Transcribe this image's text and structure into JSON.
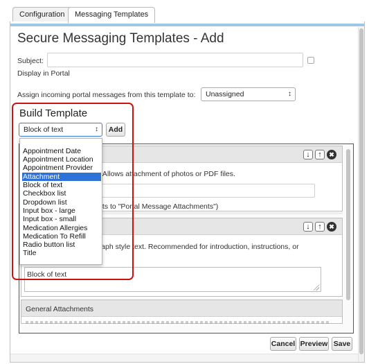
{
  "tabs": [
    {
      "label": "Configuration",
      "active": false
    },
    {
      "label": "Messaging Templates",
      "active": true
    }
  ],
  "form": {
    "title": "Secure Messaging Templates - Add",
    "subject_label": "Subject:",
    "subject_value": "",
    "display_in_portal_label": "Display in Portal",
    "display_in_portal_checked": false,
    "assign_label": "Assign incoming portal messages from this template to:",
    "assign_value": "Unassigned"
  },
  "build": {
    "title": "Build Template",
    "type_select_value": "Block of text",
    "add_label": "Add",
    "options": [
      "Appointment Date",
      "Appointment Location",
      "Appointment Provider",
      "Attachment",
      "Block of text",
      "Checkbox list",
      "Dropdown list",
      "Input box - large",
      "Input box - small",
      "Medication Allergies",
      "Medication To Refill",
      "Radio button list",
      "Title"
    ],
    "highlighted_option": "Attachment"
  },
  "cards": [
    {
      "desc": "on. Allows attachment of photos or PDF files.",
      "folder_hint": "faults to \"Portal Message Attachments\")"
    },
    {
      "desc": "agraph style text. Recommended for introduction, instructions, or",
      "textarea_value": "Block of text"
    },
    {
      "title": "General Attachments"
    }
  ],
  "icons": {
    "move_down": "↓",
    "move_up": "↑",
    "remove": "✖"
  },
  "actions": {
    "cancel": "Cancel",
    "preview": "Preview",
    "save": "Save"
  },
  "colors": {
    "accent_bar": "#9ec7e6",
    "highlight_border": "#cc1111",
    "selected_option": "#2e72d9"
  }
}
